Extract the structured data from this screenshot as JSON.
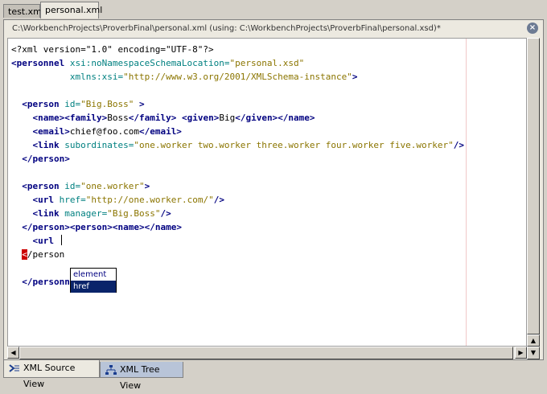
{
  "tabs": [
    {
      "label": "test.xml",
      "active": false
    },
    {
      "label": "personal.xml",
      "active": true
    }
  ],
  "editor": {
    "path": "C:\\WorkbenchProjects\\ProverbFinal\\personal.xml (using: C:\\WorkbenchProjects\\ProverbFinal\\personal.xsd)*",
    "close_label": "×"
  },
  "code": {
    "l1": "<?xml version=\"1.0\" encoding=\"UTF-8\"?>",
    "personnel_open": "<personnel",
    "xsi_ns_attr": "xsi:noNamespaceSchemaLocation=",
    "xsi_ns_val": "\"personal.xsd\"",
    "xmlns_attr": "xmlns:xsi=",
    "xmlns_val": "\"http://www.w3.org/2001/XMLSchema-instance\"",
    "close_bracket": ">",
    "person_open": "<person",
    "id_attr": "id=",
    "bigboss_val": "\"Big.Boss\"",
    "name_open": "<name>",
    "family_open": "<family>",
    "family_text": "Boss",
    "family_close": "</family>",
    "given_open": "<given>",
    "given_text": "Big",
    "given_close": "</given>",
    "name_close": "</name>",
    "email_open": "<email>",
    "email_text": "chief@foo.com",
    "email_close": "</email>",
    "link_open": "<link",
    "subordinates_attr": "subordinates=",
    "subordinates_val": "\"one.worker two.worker three.worker four.worker five.worker\"",
    "self_close": "/>",
    "person_close": "</person>",
    "oneworker_val": "\"one.worker\"",
    "url_open": "<url",
    "href_attr": "href=",
    "href_val": "\"http://one.worker.com/\"",
    "manager_attr": "manager=",
    "person_open_full": "<person>",
    "name_empty": "<name></name>",
    "url_typing": "<url ",
    "err_char": "<",
    "person_close_partial": "/person",
    "personnel_close": "</personnel>"
  },
  "autocomplete": {
    "items": [
      {
        "label": "element",
        "selected": false
      },
      {
        "label": "href",
        "selected": true
      }
    ]
  },
  "scrollbars": {
    "up_arrow": "▲",
    "down_arrow": "▼",
    "left_arrow": "◀",
    "right_arrow": "▶"
  },
  "bottom_tabs": [
    {
      "label": "XML Source View",
      "icon": "source-view-icon",
      "active": true
    },
    {
      "label": "XML Tree View",
      "icon": "tree-view-icon",
      "active": false
    }
  ]
}
